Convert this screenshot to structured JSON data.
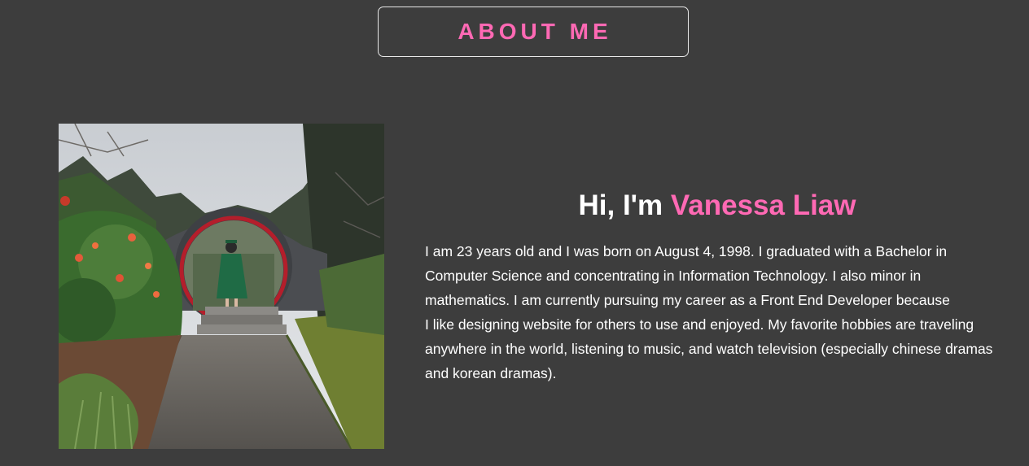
{
  "section": {
    "title": "ABOUT ME"
  },
  "colors": {
    "background": "#3d3d3d",
    "accent": "#ff69b4",
    "text": "#ffffff",
    "border": "#e8e8e8"
  },
  "photo": {
    "description": "photo-garden-moon-gate-graduate"
  },
  "intro": {
    "greeting_prefix": "Hi, I'm ",
    "name": "Vanessa Liaw"
  },
  "bio": {
    "lines": [
      "I am 23 years old and I was born on August 4, 1998. I graduated with a Bachelor in",
      "Computer Science and concentrating in Information Technology. I also minor in",
      "mathematics. I am currently pursuing my career as a Front End Developer because",
      "I like designing website for others to use and enjoyed. My favorite hobbies are traveling",
      "anywhere in the world, listening to music, and watch television (especially chinese dramas",
      "and korean dramas)."
    ]
  }
}
